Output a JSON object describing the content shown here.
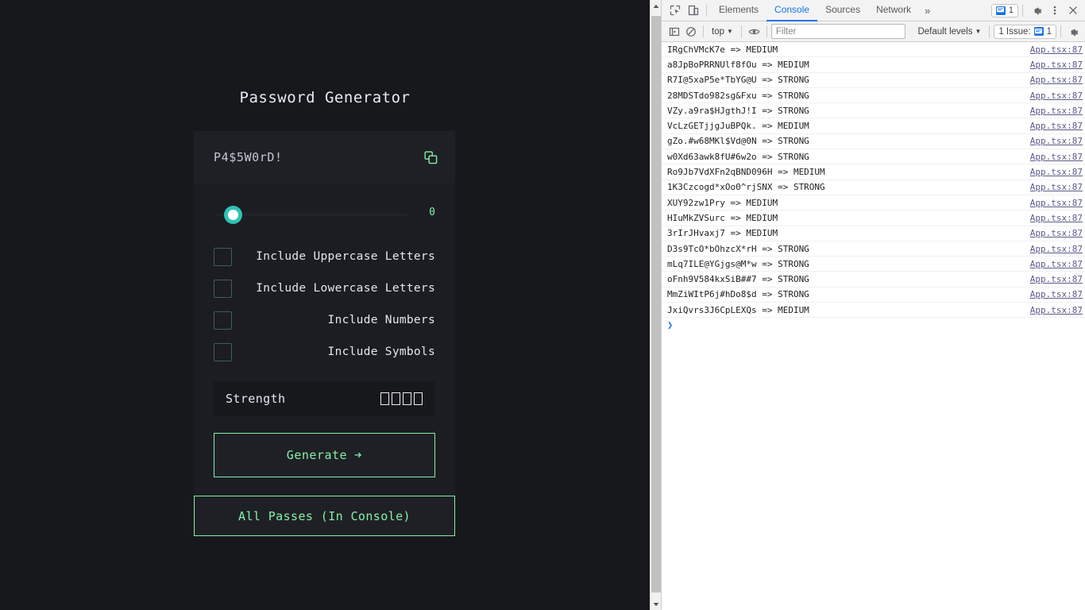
{
  "page": {
    "title": "Password Generator",
    "password": {
      "value": "P4$5W0rD!",
      "copy_icon": "copy-icon"
    },
    "length_slider": {
      "value": "0",
      "min": "0",
      "max": "100"
    },
    "options": [
      {
        "label": "Include Uppercase Letters",
        "checked": false
      },
      {
        "label": "Include Lowercase Letters",
        "checked": false
      },
      {
        "label": "Include Numbers",
        "checked": false
      },
      {
        "label": "Include Symbols",
        "checked": false
      }
    ],
    "strength": {
      "label": "Strength",
      "meter_blocks": 4
    },
    "generate_button": {
      "label": "Generate",
      "arrow": "➔"
    },
    "all_passes_button": {
      "label": "All Passes (In Console)"
    },
    "colors": {
      "background": "#17181c",
      "panel": "#1b1d22",
      "inset": "#1e2026",
      "accent_green": "#86efa4",
      "accent_teal": "#2ec4b6",
      "text": "#e4e7ee"
    }
  },
  "devtools": {
    "tabs": [
      {
        "label": "Elements",
        "active": false
      },
      {
        "label": "Console",
        "active": true
      },
      {
        "label": "Sources",
        "active": false
      },
      {
        "label": "Network",
        "active": false
      }
    ],
    "more_tabs_glyph": "»",
    "messages_badge": "1",
    "toolbar_icons": {
      "inspect": "inspect-element-icon",
      "device": "device-toolbar-icon",
      "settings": "gear-icon",
      "more": "more-options-icon",
      "close": "close-icon"
    },
    "console_toolbar": {
      "sidebar_toggle": "console-sidebar-icon",
      "clear": "clear-console-icon",
      "context": "top",
      "context_caret": "▼",
      "eye": "live-expression-icon",
      "filter_placeholder": "Filter",
      "filter_value": "",
      "levels": "Default levels",
      "levels_caret": "▼",
      "issues_label": "1 Issue:",
      "issues_count": "1",
      "settings": "console-settings-icon"
    },
    "logs": [
      {
        "message": "IRgChVMcK7e => MEDIUM",
        "source": "App.tsx:87"
      },
      {
        "message": "a8JpBoPRRNUlf8fOu => MEDIUM",
        "source": "App.tsx:87"
      },
      {
        "message": "R7I@5xaP5e*TbYG@U => STRONG",
        "source": "App.tsx:87"
      },
      {
        "message": "28MDSTdo982sg&Fxu => STRONG",
        "source": "App.tsx:87"
      },
      {
        "message": "VZy.a9ra$HJgthJ!I => STRONG",
        "source": "App.tsx:87"
      },
      {
        "message": "VcLzGETjjgJuBPQk. => MEDIUM",
        "source": "App.tsx:87"
      },
      {
        "message": "gZo.#w68MKl$Vd@0N => STRONG",
        "source": "App.tsx:87"
      },
      {
        "message": "w0Xd63awk8fU#6w2o => STRONG",
        "source": "App.tsx:87"
      },
      {
        "message": "Ro9Jb7VdXFn2qBND096H => MEDIUM",
        "source": "App.tsx:87"
      },
      {
        "message": "1K3Czcogd*xOo0^rjSNX => STRONG",
        "source": "App.tsx:87"
      },
      {
        "message": "XUY92zw1Pry => MEDIUM",
        "source": "App.tsx:87"
      },
      {
        "message": "HIuMkZVSurc => MEDIUM",
        "source": "App.tsx:87"
      },
      {
        "message": "3rIrJHvaxj7 => MEDIUM",
        "source": "App.tsx:87"
      },
      {
        "message": "D3s9TcO*bOhzcX*rH => STRONG",
        "source": "App.tsx:87"
      },
      {
        "message": "mLq7ILE@YGjgs@M*w => STRONG",
        "source": "App.tsx:87"
      },
      {
        "message": "oFnh9V584kxSiB##7 => STRONG",
        "source": "App.tsx:87"
      },
      {
        "message": "MmZiWItP6j#hDo8$d => STRONG",
        "source": "App.tsx:87"
      },
      {
        "message": "JxiQvrs3J6CpLEXQs => MEDIUM",
        "source": "App.tsx:87"
      }
    ],
    "prompt_caret": "❯"
  }
}
